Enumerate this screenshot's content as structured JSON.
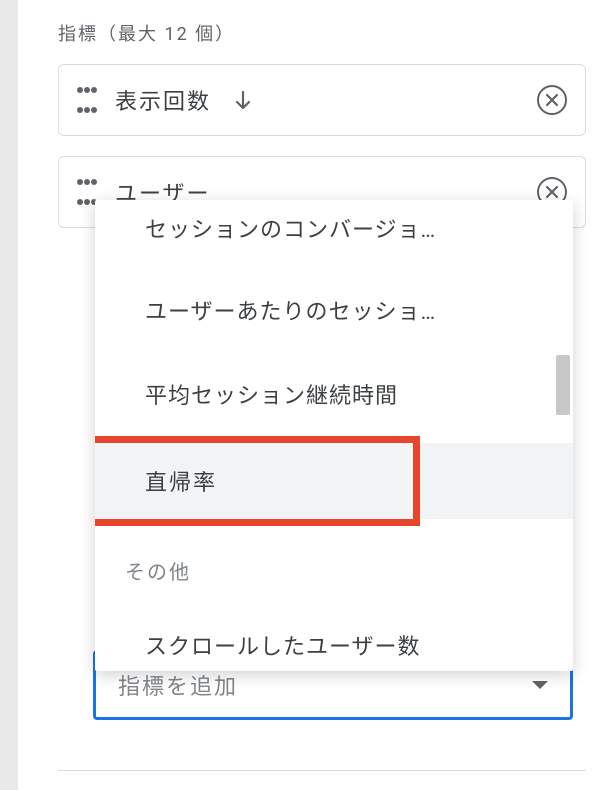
{
  "section": {
    "header": "指標（最大 12 個）"
  },
  "metrics": [
    {
      "label": "表示回数",
      "has_sort_arrow": true
    },
    {
      "label": "ユーザー",
      "has_sort_arrow": false
    }
  ],
  "dropdown": {
    "items": [
      {
        "label": "セッションのコンバージョ…",
        "truncated": true
      },
      {
        "label": "ユーザーあたりのセッショ…",
        "truncated": true
      },
      {
        "label": "平均セッション継続時間",
        "truncated": false
      },
      {
        "label": "直帰率",
        "truncated": false,
        "highlighted": true
      }
    ],
    "category_label": "その他",
    "post_category_items": [
      {
        "label": "スクロールしたユーザー数",
        "truncated": false
      }
    ]
  },
  "add_metric": {
    "placeholder": "指標を追加"
  },
  "icons": {
    "drag": "drag-handle",
    "sort_down": "arrow-down",
    "remove": "close-circle",
    "caret": "caret-down"
  },
  "highlight_color": "#e8452d",
  "focus_color": "#1a73e8"
}
